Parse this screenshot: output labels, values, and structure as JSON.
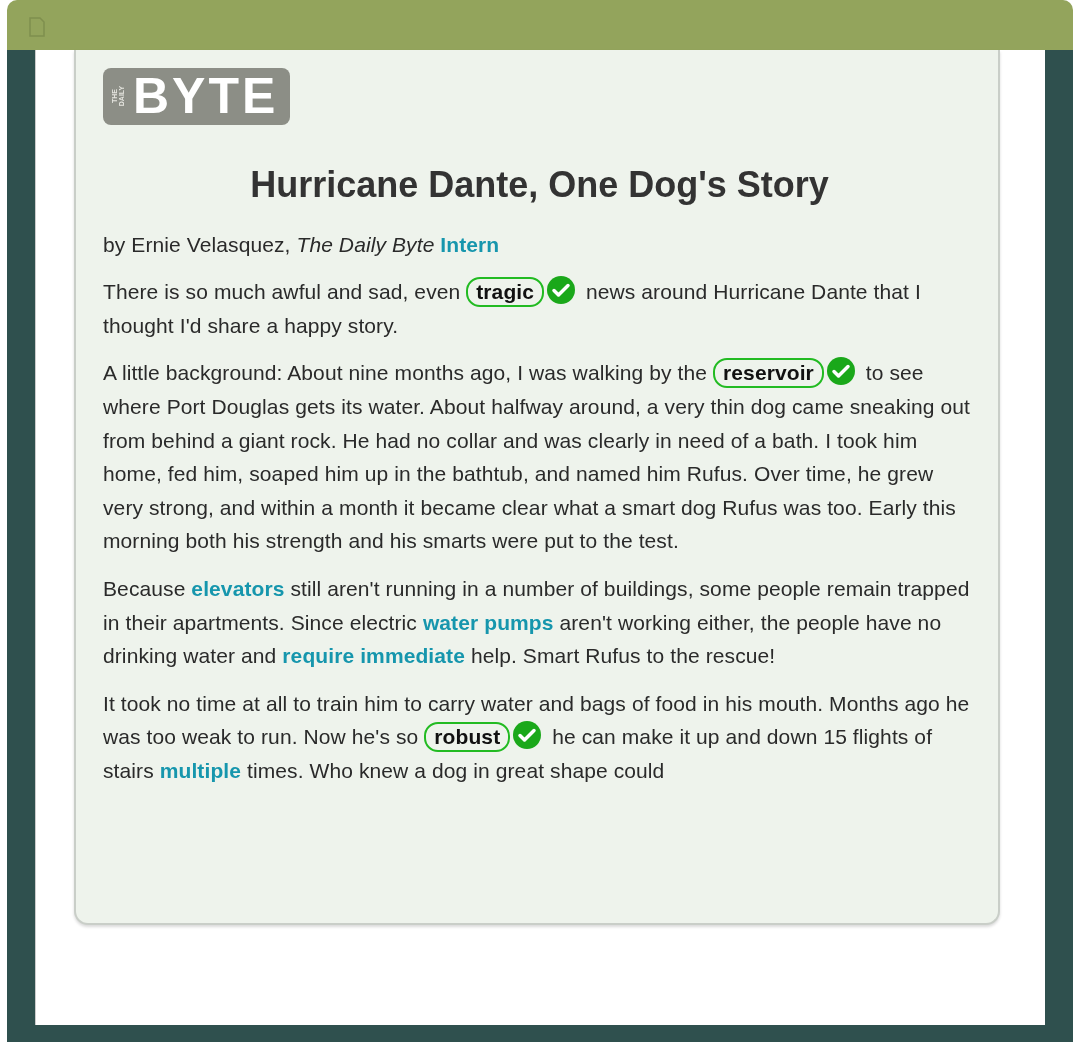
{
  "logo": {
    "small_lines": [
      "THE",
      "DAILY"
    ],
    "name": "BYTE"
  },
  "article": {
    "title": "Hurricane Dante, One Dog's Story",
    "byline": [
      {
        "kind": "text",
        "text": "by Ernie Velasquez, *The Daily Byte* "
      },
      {
        "kind": "link",
        "text": "Intern"
      }
    ],
    "paragraphs": [
      [
        {
          "kind": "text",
          "text": "There is so much awful and sad, even "
        },
        {
          "kind": "answer",
          "text": "tragic",
          "correct": true
        },
        {
          "kind": "text",
          "text": " news around Hurricane Dante that I thought I'd share a happy story."
        }
      ],
      [
        {
          "kind": "text",
          "text": "A little background: About nine months ago, I was walking by the "
        },
        {
          "kind": "answer",
          "text": "reservoir",
          "correct": true
        },
        {
          "kind": "text",
          "text": " to see where Port Douglas gets its water. About halfway around, a very thin dog came sneaking out from behind a giant rock. He had no collar and was clearly in need of a bath. I took him home, fed him, soaped him up in the bathtub, and named him Rufus. Over time, he grew very strong, and within a month it became clear what a smart dog Rufus was too. Early this morning both his strength and his smarts were put to the test."
        }
      ],
      [
        {
          "kind": "text",
          "text": "Because "
        },
        {
          "kind": "link",
          "text": "elevators"
        },
        {
          "kind": "text",
          "text": " still aren't running in a number of buildings, some people remain trapped in their apartments. Since electric "
        },
        {
          "kind": "link",
          "text": "water pumps"
        },
        {
          "kind": "text",
          "text": " aren't working either, the people have no drinking water and "
        },
        {
          "kind": "link",
          "text": "require immediate"
        },
        {
          "kind": "text",
          "text": " help. Smart Rufus to the rescue!"
        }
      ],
      [
        {
          "kind": "text",
          "text": "It took no time at all to train him to carry water and bags of food in his mouth. Months ago he was too weak to run. Now he's so "
        },
        {
          "kind": "answer",
          "text": "robust",
          "correct": true
        },
        {
          "kind": "text",
          "text": " he can make it up and down 15 flights of stairs "
        },
        {
          "kind": "link",
          "text": "multiple"
        },
        {
          "kind": "text",
          "text": " times. Who knew a dog in great shape could"
        }
      ]
    ]
  }
}
